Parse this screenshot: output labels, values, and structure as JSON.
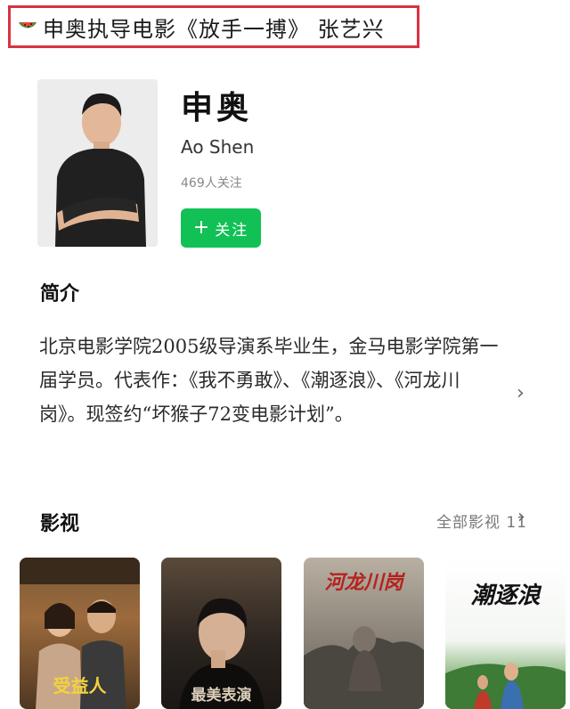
{
  "headline": {
    "text": "申奥执导电影《放手一搏》 张艺兴",
    "icon": "watermelon-icon"
  },
  "profile": {
    "name_cn": "申奥",
    "name_en": "Ao Shen",
    "followers": "469人关注",
    "follow_button": "关注",
    "follow_icon": "plus-icon"
  },
  "intro": {
    "title": "简介",
    "text": "北京电影学院2005级导演系毕业生，金马电影学院第一届学员。代表作：《我不勇敢》、《潮逐浪》、《河龙川岗》。现签约“坏猴子72变电影计划”。"
  },
  "films": {
    "title": "影视",
    "all_link": "全部影视 11",
    "posters": [
      {
        "caption": "受益人"
      },
      {
        "caption": "最美表演"
      },
      {
        "caption": "河龙川岗"
      },
      {
        "caption": "潮逐浪"
      }
    ]
  },
  "colors": {
    "accent_green": "#11c156",
    "highlight_border": "#d9333f"
  }
}
